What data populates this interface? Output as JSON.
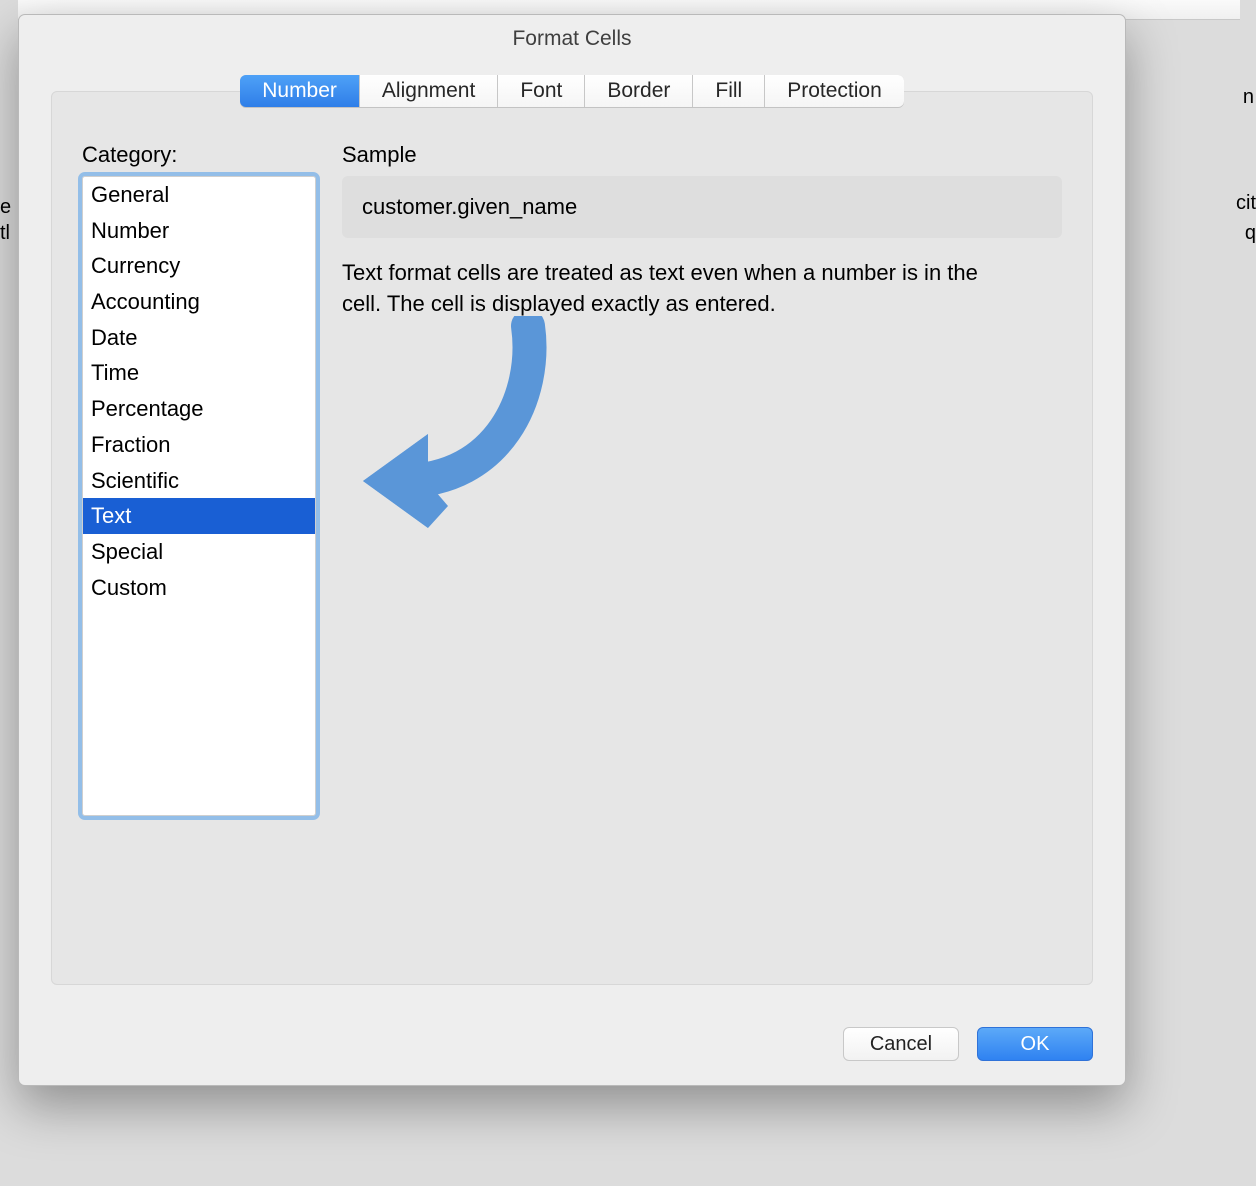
{
  "dialog": {
    "title": "Format Cells",
    "tabs": [
      {
        "label": "Number",
        "active": true
      },
      {
        "label": "Alignment",
        "active": false
      },
      {
        "label": "Font",
        "active": false
      },
      {
        "label": "Border",
        "active": false
      },
      {
        "label": "Fill",
        "active": false
      },
      {
        "label": "Protection",
        "active": false
      }
    ],
    "category_label": "Category:",
    "categories": [
      {
        "label": "General",
        "selected": false
      },
      {
        "label": "Number",
        "selected": false
      },
      {
        "label": "Currency",
        "selected": false
      },
      {
        "label": "Accounting",
        "selected": false
      },
      {
        "label": "Date",
        "selected": false
      },
      {
        "label": "Time",
        "selected": false
      },
      {
        "label": "Percentage",
        "selected": false
      },
      {
        "label": "Fraction",
        "selected": false
      },
      {
        "label": "Scientific",
        "selected": false
      },
      {
        "label": "Text",
        "selected": true
      },
      {
        "label": "Special",
        "selected": false
      },
      {
        "label": "Custom",
        "selected": false
      }
    ],
    "sample_label": "Sample",
    "sample_value": "customer.given_name",
    "description": "Text format cells are treated as text even when a number is in the cell.  The cell is displayed exactly as entered.",
    "buttons": {
      "cancel": "Cancel",
      "ok": "OK"
    }
  },
  "bg": {
    "left1": "e",
    "left2": "tl",
    "right1": "n",
    "right2": "cit",
    "right3": "q"
  }
}
